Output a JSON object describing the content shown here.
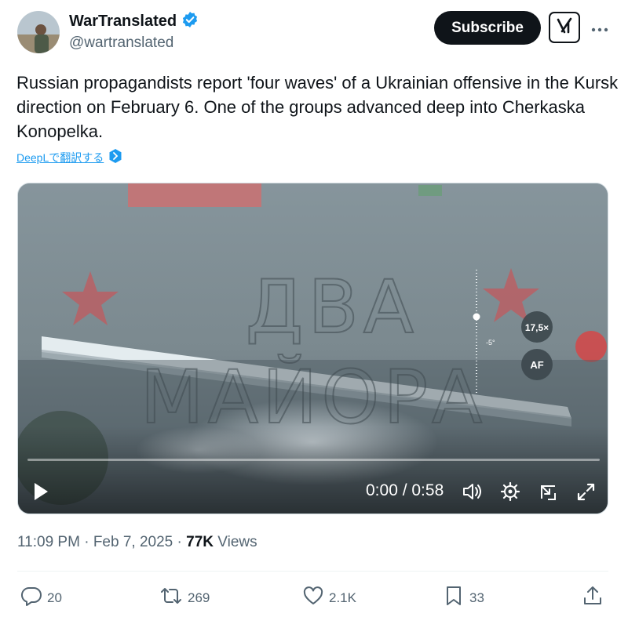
{
  "author": {
    "name": "WarTranslated",
    "handle": "@wartranslated",
    "verified": true
  },
  "header": {
    "subscribe_label": "Subscribe"
  },
  "tweet": {
    "text": "Russian propagandists report 'four waves' of a Ukrainian offensive in the Kursk direction on February 6. One of the groups advanced deep into Cherkaska Konopelka.",
    "translate_label": "DeepLで翻訳する"
  },
  "video": {
    "time": "0:00 / 0:58",
    "watermark": "ДВА МАЙОРА",
    "zoom_label": "17,5×",
    "af_label": "AF",
    "scale_label": "-5°",
    "progress": 0
  },
  "meta": {
    "time": "11:09 PM",
    "date": "Feb 7, 2025",
    "views_count": "77K",
    "views_label": "Views"
  },
  "actions": {
    "replies": "20",
    "reposts": "269",
    "likes": "2.1K",
    "bookmarks": "33"
  },
  "colors": {
    "accent": "#1d9bf0",
    "text": "#0f1419",
    "secondary": "#536471",
    "verified": "#1d9bf0"
  }
}
